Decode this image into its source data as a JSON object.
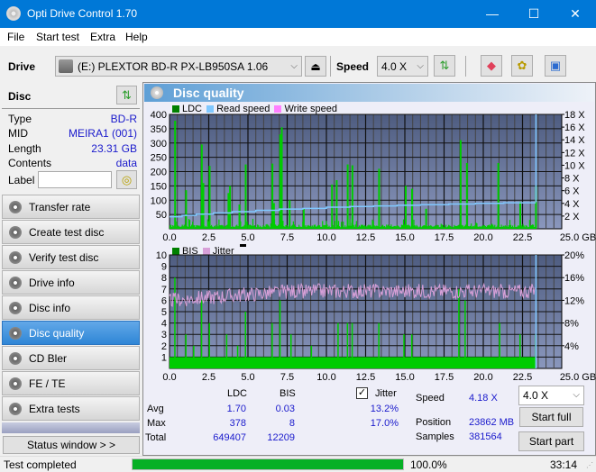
{
  "window": {
    "title": "Opti Drive Control 1.70",
    "minimize": "—",
    "maximize": "☐",
    "close": "✕"
  },
  "menu": [
    "File",
    "Start test",
    "Extra",
    "Help"
  ],
  "toolbar": {
    "drive_label": "Drive",
    "drive_value": "(E:)  PLEXTOR BD-R  PX-LB950SA 1.06",
    "speed_label": "Speed",
    "speed_value": "4.0 X",
    "icons": [
      "eject-icon",
      "refresh-icon",
      "erase-icon",
      "settings-icon",
      "save-icon"
    ]
  },
  "disc": {
    "header": "Disc",
    "rows": [
      {
        "label": "Type",
        "value": "BD-R"
      },
      {
        "label": "MID",
        "value": "MEIRA1 (001)"
      },
      {
        "label": "Length",
        "value": "23.31 GB"
      },
      {
        "label": "Contents",
        "value": "data"
      }
    ],
    "label_field": {
      "label": "Label",
      "value": ""
    }
  },
  "nav": [
    {
      "label": "Transfer rate",
      "active": false
    },
    {
      "label": "Create test disc",
      "active": false
    },
    {
      "label": "Verify test disc",
      "active": false
    },
    {
      "label": "Drive info",
      "active": false
    },
    {
      "label": "Disc info",
      "active": false
    },
    {
      "label": "Disc quality",
      "active": true
    },
    {
      "label": "CD Bler",
      "active": false
    },
    {
      "label": "FE / TE",
      "active": false
    },
    {
      "label": "Extra tests",
      "active": false
    }
  ],
  "status_window_button": "Status window > >",
  "panel_title": "Disc quality",
  "chart_data": [
    {
      "type": "bar",
      "title": "LDC / Read speed",
      "legend": [
        "LDC",
        "Read speed",
        "Write speed"
      ],
      "legend_colors": {
        "LDC": "#008000",
        "Read speed": "#80c8ff",
        "Write speed": "#ff80ff"
      },
      "xlabel": "GB",
      "x_ticks": [
        "0.0",
        "2.5",
        "5.0",
        "7.5",
        "10.0",
        "12.5",
        "15.0",
        "17.5",
        "20.0",
        "22.5",
        "25.0 GB"
      ],
      "xlim": [
        0,
        25
      ],
      "y_ticks_left": [
        "50",
        "100",
        "150",
        "200",
        "250",
        "300",
        "350",
        "400"
      ],
      "ylim_left": [
        0,
        400
      ],
      "y_ticks_right": [
        "2 X",
        "4 X",
        "6 X",
        "8 X",
        "10 X",
        "12 X",
        "14 X",
        "16 X",
        "18 X"
      ],
      "ylim_right": [
        0,
        18
      ],
      "ldc_peaks": [
        {
          "x": 0.3,
          "y": 378
        },
        {
          "x": 1.0,
          "y": 135
        },
        {
          "x": 2.0,
          "y": 295
        },
        {
          "x": 2.1,
          "y": 160
        },
        {
          "x": 2.5,
          "y": 220
        },
        {
          "x": 3.7,
          "y": 125
        },
        {
          "x": 3.8,
          "y": 150
        },
        {
          "x": 4.4,
          "y": 85
        },
        {
          "x": 4.8,
          "y": 225
        },
        {
          "x": 6.5,
          "y": 228
        },
        {
          "x": 6.6,
          "y": 90
        },
        {
          "x": 7.0,
          "y": 330
        },
        {
          "x": 7.1,
          "y": 355
        },
        {
          "x": 7.6,
          "y": 100
        },
        {
          "x": 8.5,
          "y": 70
        },
        {
          "x": 10.3,
          "y": 155
        },
        {
          "x": 10.6,
          "y": 170
        },
        {
          "x": 11.3,
          "y": 225
        },
        {
          "x": 11.6,
          "y": 222
        },
        {
          "x": 13.3,
          "y": 210
        },
        {
          "x": 15.0,
          "y": 150
        },
        {
          "x": 15.4,
          "y": 140
        },
        {
          "x": 16.3,
          "y": 70
        },
        {
          "x": 18.5,
          "y": 310
        },
        {
          "x": 18.9,
          "y": 230
        },
        {
          "x": 20.9,
          "y": 230
        },
        {
          "x": 22.3,
          "y": 95
        },
        {
          "x": 23.3,
          "y": 150
        }
      ],
      "ldc_baseline": 5,
      "read_speed": [
        {
          "x": 0.0,
          "y": 1.9
        },
        {
          "x": 0.8,
          "y": 2.1
        },
        {
          "x": 1.7,
          "y": 2.3
        },
        {
          "x": 2.8,
          "y": 2.5
        },
        {
          "x": 4.0,
          "y": 2.7
        },
        {
          "x": 5.5,
          "y": 2.9
        },
        {
          "x": 7.0,
          "y": 3.1
        },
        {
          "x": 8.5,
          "y": 3.2
        },
        {
          "x": 10.0,
          "y": 3.4
        },
        {
          "x": 11.5,
          "y": 3.5
        },
        {
          "x": 13.0,
          "y": 3.6
        },
        {
          "x": 14.5,
          "y": 3.7
        },
        {
          "x": 16.0,
          "y": 3.8
        },
        {
          "x": 17.8,
          "y": 3.9
        },
        {
          "x": 19.5,
          "y": 4.0
        },
        {
          "x": 21.3,
          "y": 4.1
        },
        {
          "x": 23.3,
          "y": 4.2
        }
      ],
      "end_marker_x": 23.3
    },
    {
      "type": "bar",
      "title": "BIS / Jitter",
      "legend": [
        "BIS",
        "Jitter"
      ],
      "legend_colors": {
        "BIS": "#008000",
        "Jitter": "#d8a0d8"
      },
      "xlabel": "GB",
      "x_ticks": [
        "0.0",
        "2.5",
        "5.0",
        "7.5",
        "10.0",
        "12.5",
        "15.0",
        "17.5",
        "20.0",
        "22.5",
        "25.0 GB"
      ],
      "xlim": [
        0,
        25
      ],
      "y_ticks_left": [
        "1",
        "2",
        "3",
        "4",
        "5",
        "6",
        "7",
        "8",
        "9",
        "10"
      ],
      "ylim_left": [
        0,
        10
      ],
      "y_ticks_right": [
        "4%",
        "8%",
        "12%",
        "16%",
        "20%"
      ],
      "ylim_right": [
        0,
        20
      ],
      "bis_peaks": [
        {
          "x": 0.3,
          "y": 8
        },
        {
          "x": 1.0,
          "y": 3
        },
        {
          "x": 1.5,
          "y": 2
        },
        {
          "x": 2.0,
          "y": 6
        },
        {
          "x": 2.5,
          "y": 4
        },
        {
          "x": 3.6,
          "y": 3
        },
        {
          "x": 4.3,
          "y": 2
        },
        {
          "x": 4.8,
          "y": 5
        },
        {
          "x": 6.5,
          "y": 4
        },
        {
          "x": 7.0,
          "y": 6
        },
        {
          "x": 7.7,
          "y": 3
        },
        {
          "x": 9.0,
          "y": 2
        },
        {
          "x": 10.7,
          "y": 4
        },
        {
          "x": 11.3,
          "y": 4
        },
        {
          "x": 11.6,
          "y": 4
        },
        {
          "x": 13.3,
          "y": 4
        },
        {
          "x": 14.9,
          "y": 3
        },
        {
          "x": 15.4,
          "y": 3
        },
        {
          "x": 18.4,
          "y": 7
        },
        {
          "x": 18.8,
          "y": 6
        },
        {
          "x": 21.0,
          "y": 4
        },
        {
          "x": 22.3,
          "y": 3
        },
        {
          "x": 23.3,
          "y": 3
        }
      ],
      "bis_baseline": 1,
      "jitter_range_pct": [
        11.5,
        17.0
      ],
      "jitter_avg_pct": 13.2,
      "end_marker_x": 23.3
    }
  ],
  "stats": {
    "col_headers": [
      "LDC",
      "BIS"
    ],
    "jitter_checkbox": {
      "label": "Jitter",
      "checked": true
    },
    "rows": [
      {
        "label": "Avg",
        "ldc": "1.70",
        "bis": "0.03",
        "jitter": "13.2%"
      },
      {
        "label": "Max",
        "ldc": "378",
        "bis": "8",
        "jitter": "17.0%"
      },
      {
        "label": "Total",
        "ldc": "649407",
        "bis": "12209",
        "jitter": ""
      }
    ],
    "speed_label": "Speed",
    "speed_value": "4.18 X",
    "position_label": "Position",
    "position_value": "23862 MB",
    "samples_label": "Samples",
    "samples_value": "381564",
    "speed_select": "4.0 X",
    "start_full": "Start full",
    "start_part": "Start part"
  },
  "statusbar": {
    "text": "Test completed",
    "progress_pct": 100.0,
    "progress_text": "100.0%",
    "time": "33:14"
  }
}
